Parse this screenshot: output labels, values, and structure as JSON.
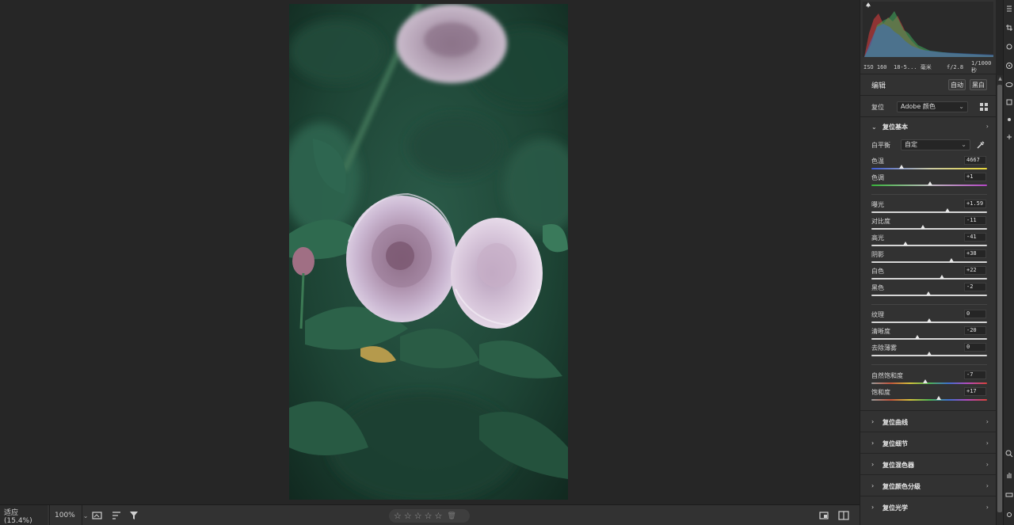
{
  "bottom_bar": {
    "zoom_fit": "适应 (15.4%)",
    "zoom_level": "100%",
    "stars": [
      "☆",
      "☆",
      "☆",
      "☆",
      "☆"
    ],
    "trash": "🗑"
  },
  "exif": {
    "iso": "ISO 160",
    "lens": "18-5... 毫米",
    "aperture": "f/2.8",
    "shutter": "1/1000 秒"
  },
  "edit": {
    "title": "编辑",
    "auto_button": "自动",
    "bw_button": "黑白"
  },
  "profile": {
    "label": "复位",
    "value": "Adobe 颜色"
  },
  "basic": {
    "title": "复位基本",
    "white_balance_label": "白平衡",
    "white_balance_value": "自定",
    "sliders": [
      {
        "key": "temp",
        "label": "色温",
        "value": "4667",
        "position": 0.26
      },
      {
        "key": "tint",
        "label": "色调",
        "value": "+1",
        "position": 0.505
      },
      {
        "key": "exposure",
        "label": "曝光",
        "value": "+1.59",
        "position": 0.66
      },
      {
        "key": "contrast",
        "label": "对比度",
        "value": "-11",
        "position": 0.445
      },
      {
        "key": "highlights",
        "label": "高光",
        "value": "-41",
        "position": 0.295
      },
      {
        "key": "shadows",
        "label": "阴影",
        "value": "+38",
        "position": 0.69
      },
      {
        "key": "whites",
        "label": "白色",
        "value": "+22",
        "position": 0.61
      },
      {
        "key": "blacks",
        "label": "黑色",
        "value": "-2",
        "position": 0.49
      },
      {
        "key": "texture",
        "label": "纹理",
        "value": "0",
        "position": 0.5
      },
      {
        "key": "clarity",
        "label": "清晰度",
        "value": "-20",
        "position": 0.4
      },
      {
        "key": "dehaze",
        "label": "去除薄雾",
        "value": "0",
        "position": 0.5
      },
      {
        "key": "vibrance",
        "label": "自然饱和度",
        "value": "-7",
        "position": 0.465
      },
      {
        "key": "saturation",
        "label": "饱和度",
        "value": "+17",
        "position": 0.585
      }
    ]
  },
  "sections": [
    "复位曲线",
    "复位细节",
    "复位混色器",
    "复位颜色分级",
    "复位光学"
  ],
  "colors": {
    "accent_thumb": "#e8e8e8",
    "panel_bg": "#323232",
    "canvas_bg": "#262626"
  }
}
